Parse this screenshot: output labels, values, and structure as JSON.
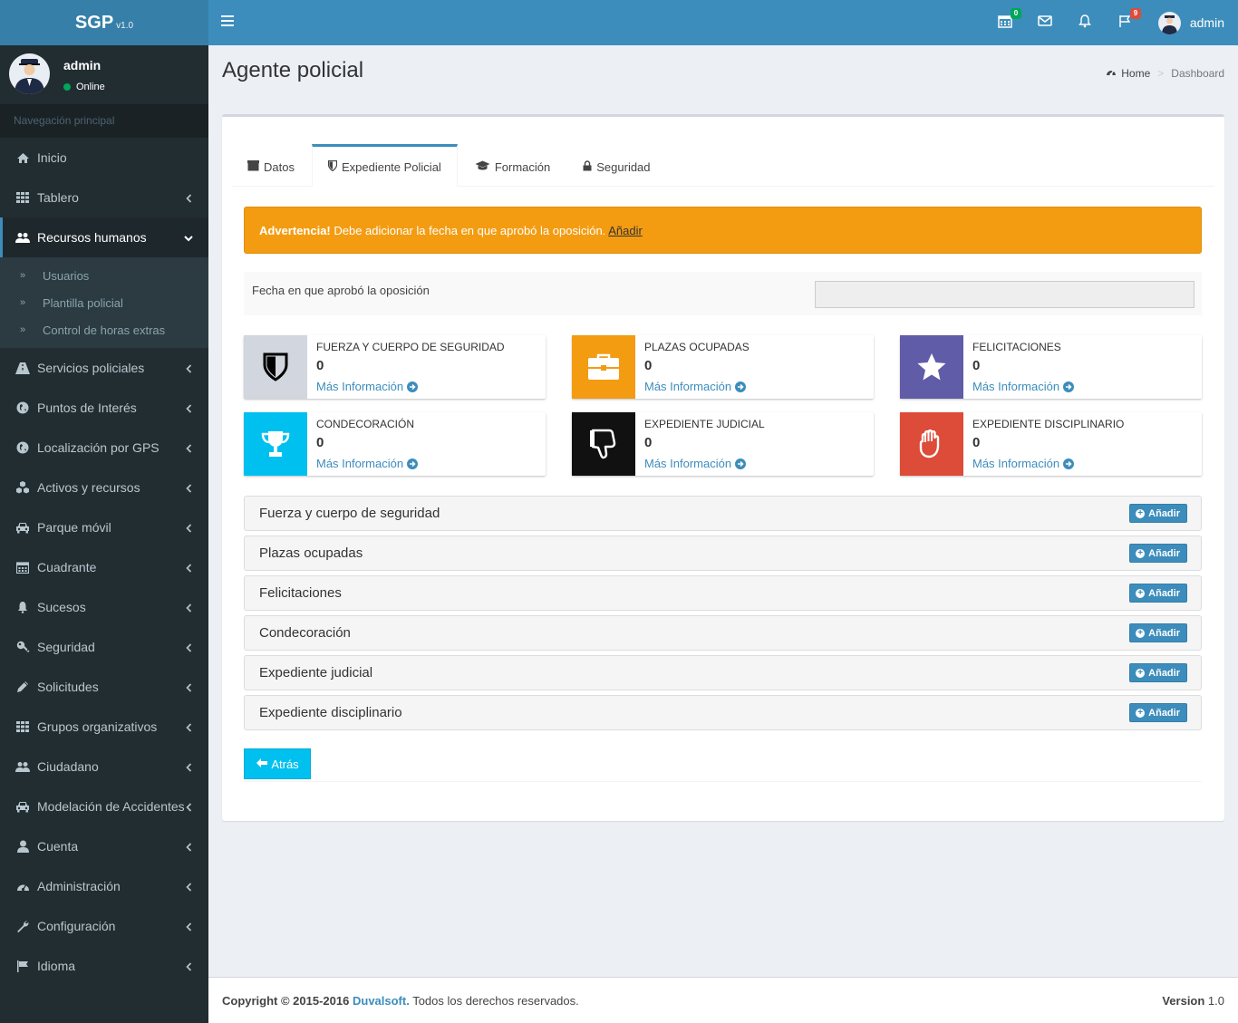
{
  "brand": {
    "name": "SGP",
    "version": "v1.0"
  },
  "navbar": {
    "calendar_badge": "0",
    "flag_badge": "9",
    "user_name": "admin",
    "colors": {
      "green_badge": "#00a65a",
      "red_badge": "#dd4b39"
    }
  },
  "sidebar": {
    "user": {
      "name": "admin",
      "status": "Online"
    },
    "header": "Navegación principal",
    "items": [
      {
        "label": "Inicio",
        "icon": "home-icon"
      },
      {
        "label": "Tablero",
        "icon": "grid-icon"
      },
      {
        "label": "Recursos humanos",
        "icon": "users-icon",
        "active": true
      },
      {
        "label": "Servicios policiales",
        "icon": "road-icon"
      },
      {
        "label": "Puntos de Interés",
        "icon": "globe-icon"
      },
      {
        "label": "Localización por GPS",
        "icon": "globe-icon"
      },
      {
        "label": "Activos y recursos",
        "icon": "cubes-icon"
      },
      {
        "label": "Parque móvil",
        "icon": "car-icon"
      },
      {
        "label": "Cuadrante",
        "icon": "calendar-icon"
      },
      {
        "label": "Sucesos",
        "icon": "bell-icon"
      },
      {
        "label": "Seguridad",
        "icon": "key-icon"
      },
      {
        "label": "Solicitudes",
        "icon": "pencil-icon"
      },
      {
        "label": "Grupos organizativos",
        "icon": "grid-icon"
      },
      {
        "label": "Ciudadano",
        "icon": "users-icon"
      },
      {
        "label": "Modelación de Accidentes",
        "icon": "car-icon"
      },
      {
        "label": "Cuenta",
        "icon": "user-icon"
      },
      {
        "label": "Administración",
        "icon": "dashboard-icon"
      },
      {
        "label": "Configuración",
        "icon": "wrench-icon"
      },
      {
        "label": "Idioma",
        "icon": "flag-icon"
      }
    ],
    "submenu": [
      "Usuarios",
      "Plantilla policial",
      "Control de horas extras"
    ]
  },
  "page": {
    "title": "Agente policial",
    "breadcrumb_home": "Home",
    "breadcrumb_current": "Dashboard"
  },
  "tabs": [
    {
      "label": "Datos",
      "icon": "id-card-icon"
    },
    {
      "label": "Expediente Policial",
      "icon": "shield-icon",
      "active": true
    },
    {
      "label": "Formación",
      "icon": "graduation-cap-icon"
    },
    {
      "label": "Seguridad",
      "icon": "lock-icon"
    }
  ],
  "alert": {
    "strong": "Advertencia!",
    "text": " Debe adicionar la fecha en que aprobó la oposición. ",
    "link": "Añadir"
  },
  "form": {
    "label": "Fecha en que aprobó la oposición",
    "value": ""
  },
  "info_boxes": [
    {
      "title": "FUERZA Y CUERPO DE SEGURIDAD",
      "number": "0",
      "more": "Más Información",
      "color": "#d2d6de",
      "icon": "shield-icon"
    },
    {
      "title": "PLAZAS OCUPADAS",
      "number": "0",
      "more": "Más Información",
      "color": "#f39c12",
      "icon": "briefcase-icon"
    },
    {
      "title": "FELICITACIONES",
      "number": "0",
      "more": "Más Información",
      "color": "#605ca8",
      "icon": "star-icon"
    },
    {
      "title": "CONDECORACIÓN",
      "number": "0",
      "more": "Más Información",
      "color": "#00c0ef",
      "icon": "trophy-icon"
    },
    {
      "title": "EXPEDIENTE JUDICIAL",
      "number": "0",
      "more": "Más Información",
      "color": "#111111",
      "icon": "thumbs-down-icon"
    },
    {
      "title": "EXPEDIENTE DISCIPLINARIO",
      "number": "0",
      "more": "Más Información",
      "color": "#dd4b39",
      "icon": "hand-icon"
    }
  ],
  "panels": [
    {
      "title": "Fuerza y cuerpo de seguridad",
      "button": "Añadir"
    },
    {
      "title": "Plazas ocupadas",
      "button": "Añadir"
    },
    {
      "title": "Felicitaciones",
      "button": "Añadir"
    },
    {
      "title": "Condecoración",
      "button": "Añadir"
    },
    {
      "title": "Expediente judicial",
      "button": "Añadir"
    },
    {
      "title": "Expediente disciplinario",
      "button": "Añadir"
    }
  ],
  "back_button": "Atrás",
  "footer": {
    "copyright": "Copyright © 2015-2016",
    "company": "Duvalsoft.",
    "rights": " Todos los derechos reservados.",
    "version_label": "Version",
    "version_value": " 1.0"
  }
}
